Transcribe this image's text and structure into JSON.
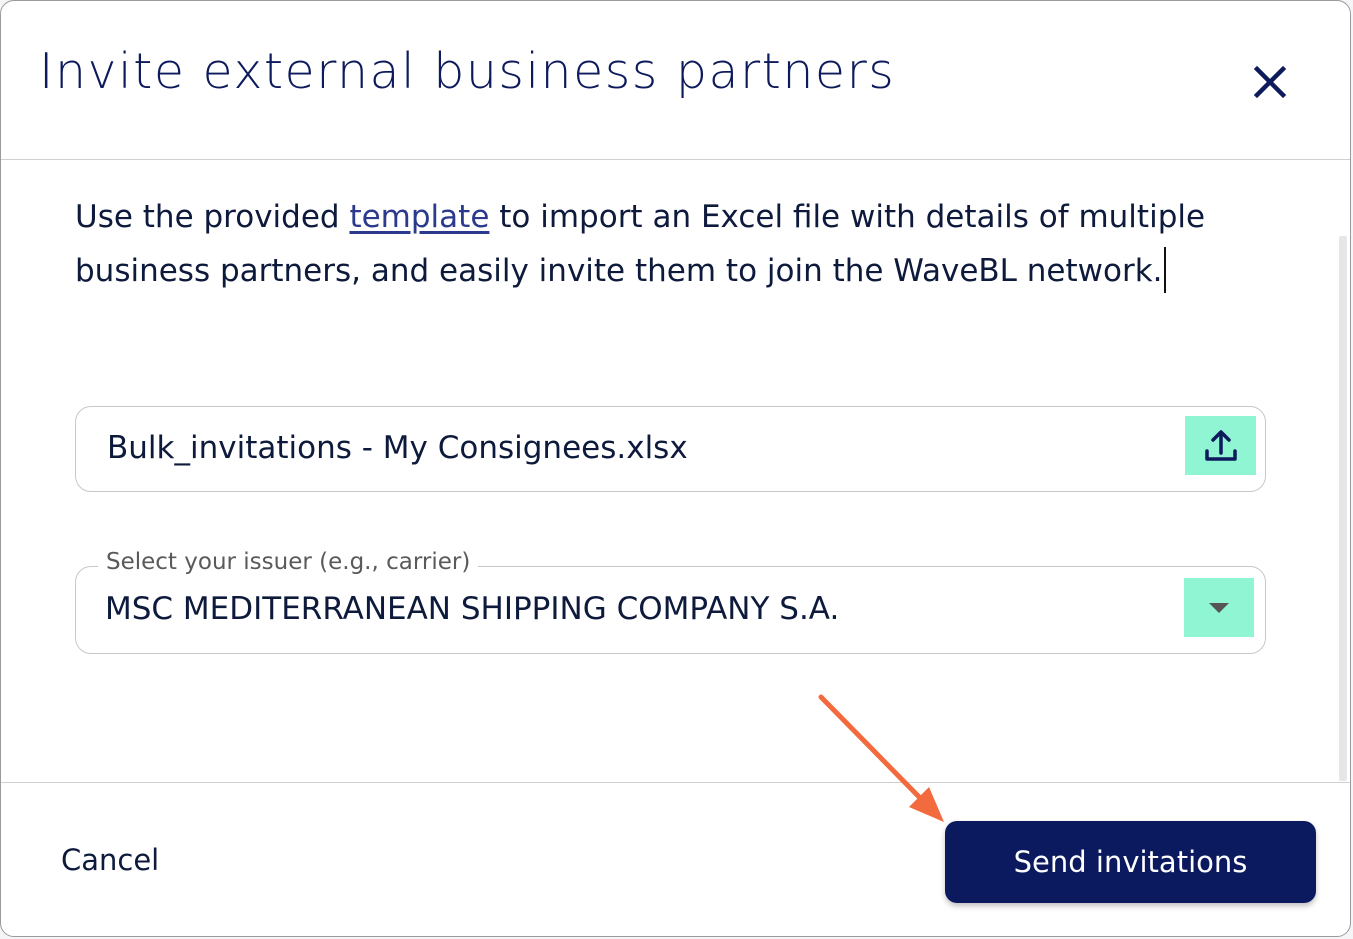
{
  "dialog": {
    "title": "Invite external business partners"
  },
  "intro": {
    "before_link": "Use the provided ",
    "link_text": "template",
    "after_link": " to import an Excel file with details of multiple business partners, and easily invite them to join the WaveBL network."
  },
  "file_upload": {
    "file_name": "Bulk_invitations - My Consignees.xlsx"
  },
  "issuer_select": {
    "label": "Select your issuer (e.g., carrier)",
    "value": "MSC MEDITERRANEAN SHIPPING COMPANY S.A."
  },
  "footer": {
    "cancel_label": "Cancel",
    "send_label": "Send invitations"
  },
  "icons": {
    "close": "close-icon",
    "upload": "upload-icon",
    "dropdown": "chevron-down-icon",
    "annotation": "arrow-annotation"
  },
  "colors": {
    "primary": "#0b1a5e",
    "accent": "#8ff5d3",
    "annotation": "#f26a3d"
  }
}
